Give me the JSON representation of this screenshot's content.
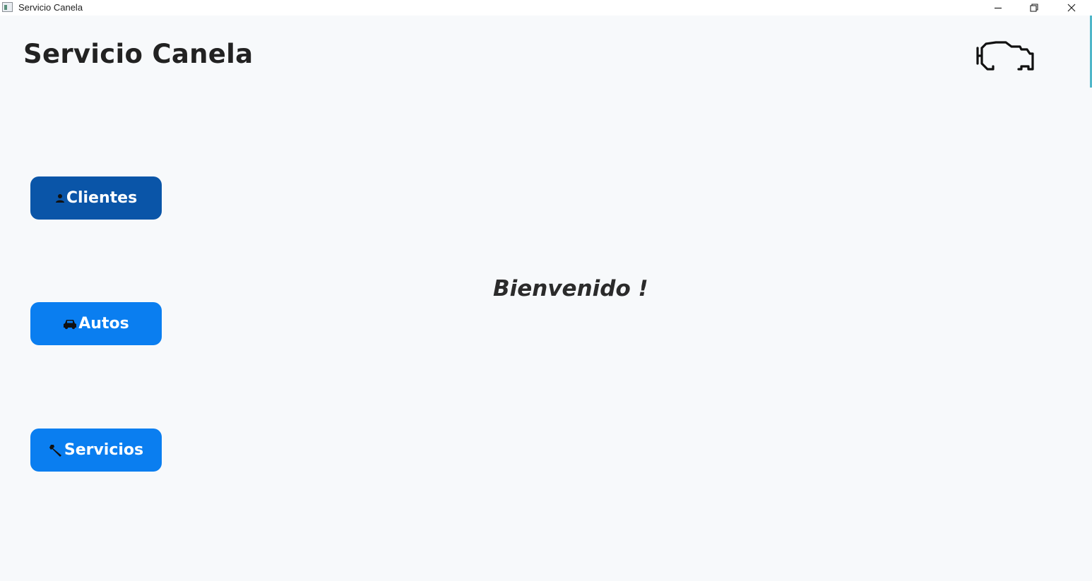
{
  "window": {
    "title": "Servicio Canela"
  },
  "header": {
    "title": "Servicio Canela",
    "logo_icon": "engine-icon"
  },
  "nav": {
    "buttons": [
      {
        "label": "Clientes",
        "icon": "person-icon",
        "color": "#0a55a8"
      },
      {
        "label": "Autos",
        "icon": "car-icon",
        "color": "#0a7ef0"
      },
      {
        "label": "Servicios",
        "icon": "wrench-icon",
        "color": "#0a7ef0"
      }
    ]
  },
  "main": {
    "welcome": "Bienvenido !"
  },
  "colors": {
    "background": "#f7f9fb",
    "button_active": "#0a55a8",
    "button_default": "#0a7ef0"
  }
}
